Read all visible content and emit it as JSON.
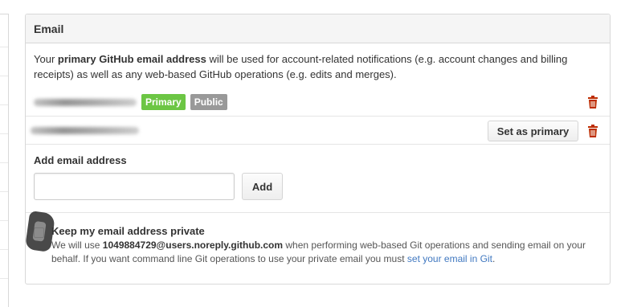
{
  "panel": {
    "title": "Email",
    "intro": {
      "prefix": "Your ",
      "bold": "primary GitHub email address",
      "suffix": " will be used for account-related notifications (e.g. account changes and billing receipts) as well as any web-based GitHub operations (e.g. edits and merges)."
    },
    "emails": [
      {
        "badges": [
          "Primary",
          "Public"
        ]
      },
      {
        "set_primary_label": "Set as primary"
      }
    ],
    "add_email": {
      "label": "Add email address",
      "input_value": "",
      "button_label": "Add"
    },
    "private": {
      "title": "Keep my email address private",
      "desc_prefix": "We will use ",
      "noreply_email": "1049884729@users.noreply.github.com",
      "desc_middle": " when performing web-based Git operations and sending email on your behalf. If you want command line Git operations to use your private email you must ",
      "link_text": "set your email in Git",
      "desc_suffix": "."
    }
  },
  "colors": {
    "primary_badge": "#6cc644",
    "public_badge": "#999999",
    "trash_icon": "#bd2c00",
    "link": "#4078c0"
  },
  "icons": [
    "trash-icon",
    "checkbox",
    "mouse-cursor"
  ]
}
